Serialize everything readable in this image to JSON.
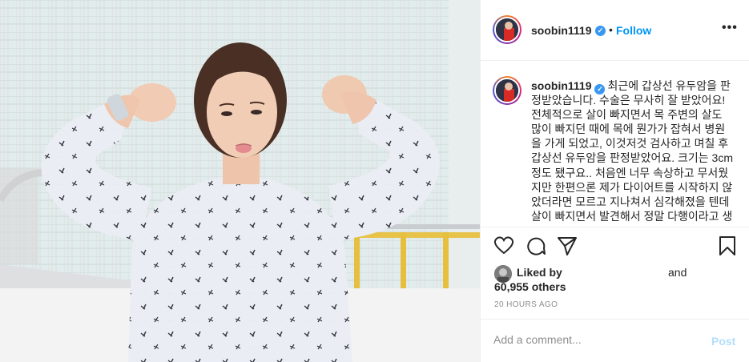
{
  "post": {
    "username": "soobin1119",
    "verified_icon": "verified-badge-icon",
    "separator": "•",
    "follow_label": "Follow",
    "more_icon": "more-options-icon",
    "more_glyph": "•••"
  },
  "caption": {
    "username": "soobin1119",
    "text": "최근에 갑상선 유두암을 판정받았습니다. 수술은 무사히 잘 받았어요! 전체적으로 살이 빠지면서 목 주변의 살도 많이 빠지던 때에 목에 뭔가가 잡혀서 병원을 가게 되었고, 이것저것 검사하고 며칠 후 갑상선 유두암을 판정받았어요. 크기는 3cm 정도 됐구요.. 처음엔 너무 속상하고 무서웠지만 한편으론 제가 다이어트를 시작하지 않았더라면 모르고 지나쳐서 심각해졌을 텐데 살이 빠지면서 발견해서 정말 다행이라고 생"
  },
  "actions": {
    "like_icon": "heart-icon",
    "comment_icon": "comment-icon",
    "share_icon": "share-icon",
    "save_icon": "bookmark-icon"
  },
  "likes": {
    "liked_by": "Liked by",
    "and": "and",
    "count": "60,955 others"
  },
  "timestamp": "20 HOURS AGO",
  "comment": {
    "placeholder": "Add a comment...",
    "post_label": "Post"
  },
  "colors": {
    "accent": "#0095f6",
    "verified": "#3897f0",
    "post_disabled": "#b2dffc",
    "muted": "#8e8e8e"
  }
}
